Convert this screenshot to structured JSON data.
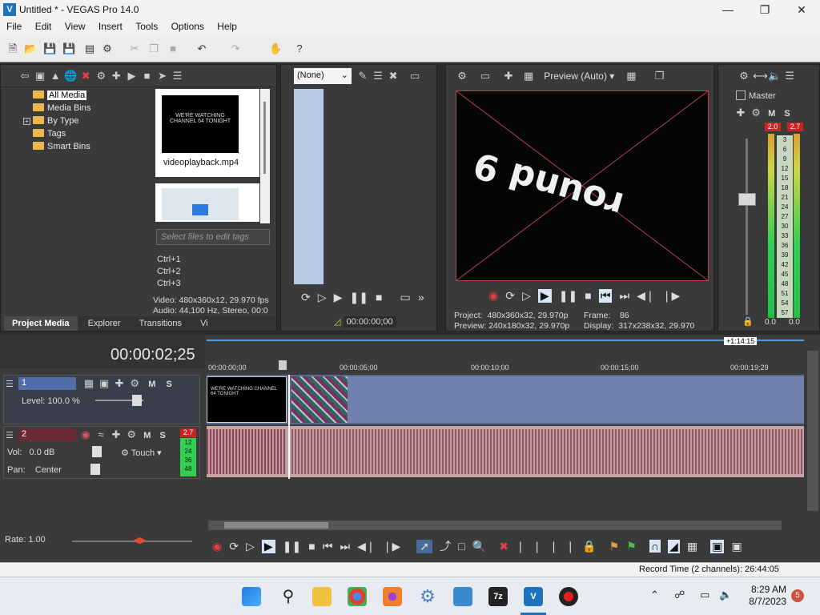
{
  "window": {
    "title": "Untitled * - VEGAS Pro 14.0",
    "logo": "V"
  },
  "menu": [
    "File",
    "Edit",
    "View",
    "Insert",
    "Tools",
    "Options",
    "Help"
  ],
  "media": {
    "tree": [
      "All Media",
      "Media Bins",
      "By Type",
      "Tags",
      "Smart Bins"
    ],
    "thumb_caption": "videoplayback.mp4",
    "thumb_text": "WE'RE WATCHING CHANNEL 64 TONIGHT",
    "tags_placeholder": "Select files to edit tags",
    "shortcuts": [
      "Ctrl+1",
      "Ctrl+2",
      "Ctrl+3"
    ],
    "info_video": "Video: 480x360x12, 29.970 fps",
    "info_audio": "Audio: 44,100 Hz, Stereo, 00:0",
    "tabs": [
      "Project Media",
      "Explorer",
      "Transitions",
      "Vi"
    ]
  },
  "trimmer": {
    "select_value": "(None)",
    "timecode": "00:00:00;00"
  },
  "preview": {
    "mode": "Preview (Auto)",
    "project_label": "Project:",
    "project_value": "480x360x32, 29.970p",
    "preview_label": "Preview:",
    "preview_value": "240x180x32, 29.970p",
    "frame_label": "Frame:",
    "frame_value": "86",
    "display_label": "Display:",
    "display_value": "317x238x32, 29.970",
    "frame_text": "round 9"
  },
  "master": {
    "title": "Master",
    "m_label": "M",
    "s_label": "S",
    "peak_left": "2.0",
    "peak_right": "2.7",
    "scale": [
      "3",
      "6",
      "9",
      "12",
      "15",
      "18",
      "21",
      "24",
      "27",
      "30",
      "33",
      "36",
      "39",
      "42",
      "45",
      "48",
      "51",
      "54",
      "57"
    ],
    "bottom_left": "0.0",
    "bottom_right": "0.0"
  },
  "timeline": {
    "cursor_time": "00:00:02;25",
    "marker": "+1:14:15",
    "ruler": [
      "00:00:00;00",
      "00:00:05;00",
      "00:00:10;00",
      "00:00:15;00",
      "00:00:19;29"
    ],
    "track1": {
      "number": "1",
      "m": "M",
      "s": "S",
      "level_label": "Level:",
      "level_value": "100.0 %"
    },
    "track2": {
      "number": "2",
      "m": "M",
      "s": "S",
      "vol_label": "Vol:",
      "vol_value": "0.0 dB",
      "pan_label": "Pan:",
      "pan_value": "Center",
      "touch": "Touch",
      "peak": "2.7",
      "meter_scale": [
        "12",
        "24",
        "36",
        "48"
      ]
    },
    "rate": "Rate: 1.00"
  },
  "status": {
    "record_time": "Record Time (2 channels): 26:44:05"
  },
  "taskbar": {
    "time": "8:29 AM",
    "date": "8/7/2023",
    "badge": "5",
    "app_7z": "7z"
  }
}
